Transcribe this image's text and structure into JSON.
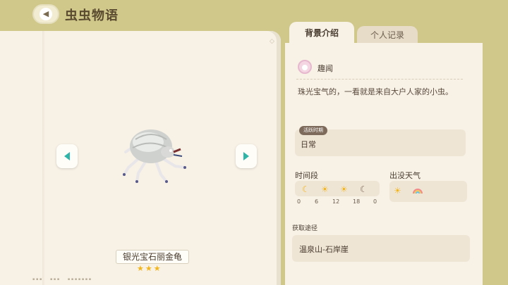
{
  "header": {
    "title": "虫虫物语"
  },
  "insect": {
    "name": "银光宝石丽金龟",
    "rating_stars": 3,
    "stars_text": "★★★"
  },
  "tabs": [
    {
      "label": "背景介绍",
      "active": true
    },
    {
      "label": "个人记录",
      "active": false
    }
  ],
  "details": {
    "trivia_label": "趣闻",
    "description": "珠光宝气的，一看就是来自大户人家的小虫。",
    "active_time_badge": "活跃时期",
    "active_time_value": "日常",
    "time_period_label": "时间段",
    "time_icons": [
      "moon-icon",
      "sunrise-icon",
      "sun-icon",
      "moon-icon"
    ],
    "time_ticks": [
      "0",
      "6",
      "12",
      "18",
      "0"
    ],
    "weather_label": "出没天气",
    "weather_icons": [
      "sun-icon",
      "rainbow-icon"
    ],
    "source_label": "获取途径",
    "source_value": "温泉山-石岸崖"
  },
  "colors": {
    "background": "#cfc88a",
    "panel": "#f7f1e6",
    "accent": "#2eb5a8",
    "star": "#f2b51c"
  }
}
